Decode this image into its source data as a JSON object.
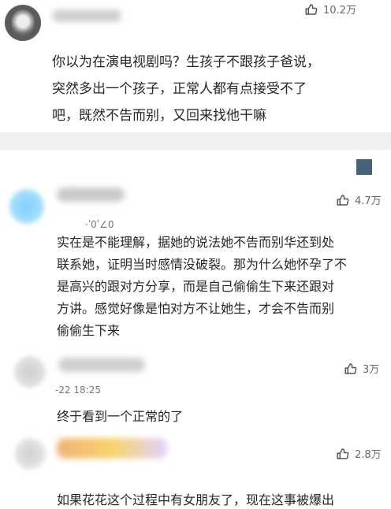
{
  "comments": [
    {
      "likes": "10.2万",
      "text_lines": [
        "你以为在演电视剧吗？生孩子不跟孩子爸说，",
        "突然多出一个孩子，正常人都有点接受不了",
        "吧，既然不告而别，又回来找他干嘛"
      ]
    },
    {
      "likes": "4.7万",
      "meta": "·ʹ0ʹ∠0",
      "text_lines": [
        "实在是不能理解，据她的说法她不告而别华还到处",
        "联系她，证明当时感情没破裂。那为什么她怀孕了不",
        "是高兴的跟对方分享，而是自己偷偷生下来还跟对",
        "方讲。感觉好像是怕对方不让她生，才会不告而别",
        "偷偷生下来"
      ]
    },
    {
      "likes": "3万",
      "meta": "-22 18:25",
      "text_lines": [
        "终于看到一个正常的了"
      ]
    },
    {
      "likes": "2.8万",
      "text_lines": [
        "如果花花这个过程中有女朋友了，现在这事被爆出"
      ]
    }
  ],
  "icons": {
    "like": "thumbs-up-icon"
  },
  "colors": {
    "separator": "#efefef",
    "badge": "#49627c",
    "text": "#262626",
    "meta": "#777777"
  }
}
